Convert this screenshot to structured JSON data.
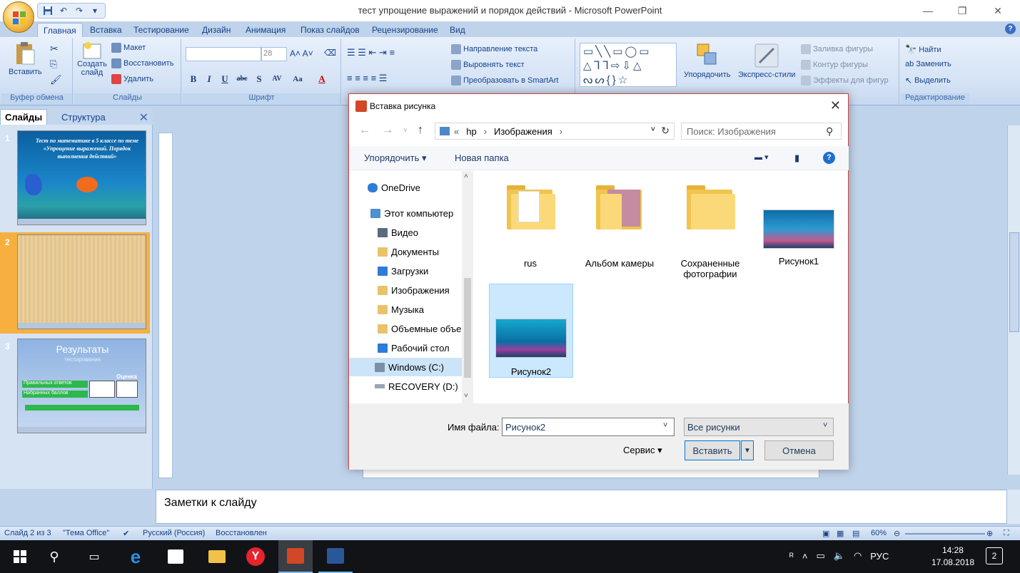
{
  "window": {
    "title": "тест упрощение выражений и порядок действий - Microsoft PowerPoint",
    "minimize": "—",
    "maximize": "❐",
    "close": "✕"
  },
  "ribbon_tabs": [
    "Главная",
    "Вставка",
    "Тестирование",
    "Дизайн",
    "Анимация",
    "Показ слайдов",
    "Рецензирование",
    "Вид"
  ],
  "ribbon": {
    "clipboard": {
      "paste": "Вставить",
      "group": "Буфер обмена"
    },
    "slides": {
      "create": "Создать",
      "create2": "слайд",
      "layout": "Макет",
      "reset": "Восстановить",
      "delete": "Удалить",
      "group": "Слайды"
    },
    "font": {
      "size": "28",
      "group": "Шрифт",
      "bold": "B",
      "italic": "I",
      "underline": "U",
      "strike": "abc",
      "shadow": "S",
      "spacing": "AV",
      "case": "Aa",
      "color": "A"
    },
    "paragraph": {
      "direction": "Направление текста",
      "align": "Выровнять текст",
      "smartart": "Преобразовать в SmartArt"
    },
    "drawing": {
      "arrange": "Упорядочить",
      "styles": "Экспресс-стили",
      "fill": "Заливка фигуры",
      "outline": "Контур фигуры",
      "effects": "Эффекты для фигур"
    },
    "editing": {
      "find": "Найти",
      "replace": "Заменить",
      "select": "Выделить",
      "group": "Редактирование"
    }
  },
  "left_pane": {
    "tab_slides": "Слайды",
    "tab_outline": "Структура",
    "slides": [
      {
        "num": "1",
        "title": "Тест по математике в 5 классе по теме «Упрощение выражений. Порядок выполнения действий»"
      },
      {
        "num": "2",
        "title": ""
      },
      {
        "num": "3",
        "title": "Результаты",
        "subtitle": "тестирования",
        "label_score": "Оценка",
        "row1": "Правильных ответов",
        "row2": "Набранных баллов"
      }
    ]
  },
  "notes": {
    "placeholder": "Заметки к слайду"
  },
  "statusbar": {
    "slide": "Слайд 2 из 3",
    "theme": "\"Тема Office\"",
    "lang": "Русский (Россия)",
    "state": "Восстановлен",
    "zoom": "60%"
  },
  "dialog": {
    "title": "Вставка рисунка",
    "path": [
      "hp",
      "Изображения"
    ],
    "path_prefix": "«",
    "search_placeholder": "Поиск: Изображения",
    "organize": "Упорядочить",
    "new_folder": "Новая папка",
    "nav": [
      {
        "label": "OneDrive",
        "icon": "cloud-icon"
      },
      {
        "label": "Этот компьютер",
        "icon": "computer-icon"
      },
      {
        "label": "Видео",
        "icon": "video-folder-icon"
      },
      {
        "label": "Документы",
        "icon": "documents-folder-icon"
      },
      {
        "label": "Загрузки",
        "icon": "downloads-folder-icon"
      },
      {
        "label": "Изображения",
        "icon": "pictures-folder-icon"
      },
      {
        "label": "Музыка",
        "icon": "music-folder-icon"
      },
      {
        "label": "Объемные объе",
        "icon": "3d-folder-icon"
      },
      {
        "label": "Рабочий стол",
        "icon": "desktop-folder-icon"
      },
      {
        "label": "Windows (C:)",
        "icon": "drive-icon"
      },
      {
        "label": "RECOVERY (D:)",
        "icon": "drive-icon"
      }
    ],
    "files": [
      {
        "label": "rus",
        "kind": "folder"
      },
      {
        "label": "Альбом камеры",
        "kind": "folder"
      },
      {
        "label": "Сохраненные фотографии",
        "kind": "folder"
      },
      {
        "label": "Рисунок1",
        "kind": "image"
      },
      {
        "label": "Рисунок2",
        "kind": "image"
      }
    ],
    "filename_label": "Имя файла:",
    "filename_value": "Рисунок2",
    "filetype": "Все рисунки",
    "service": "Сервис",
    "insert": "Вставить",
    "cancel": "Отмена"
  },
  "taskbar": {
    "time": "14:28",
    "date": "17.08.2018",
    "lang": "РУС",
    "notifications": "2"
  },
  "colors": {
    "ribbon_bg": "#d3e2f5",
    "dialog_border": "#d04545",
    "selection": "#cce8ff",
    "taskbar": "#111317"
  }
}
